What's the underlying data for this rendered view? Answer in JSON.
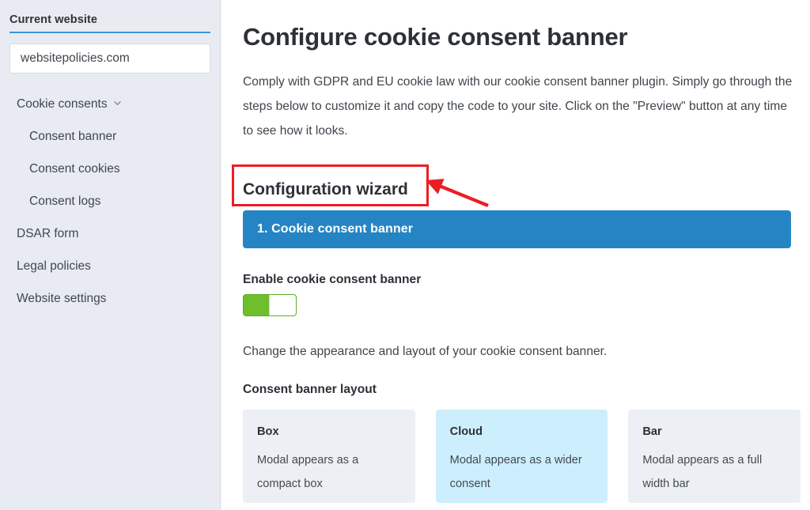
{
  "sidebar": {
    "header_title": "Current website",
    "website_select": {
      "value": "websitepolicies.com"
    },
    "items": [
      {
        "label": "Cookie consents",
        "icon": "chevron-down-icon",
        "sub": false,
        "expandable": true
      },
      {
        "label": "Consent banner",
        "sub": true
      },
      {
        "label": "Consent cookies",
        "sub": true
      },
      {
        "label": "Consent logs",
        "sub": true
      },
      {
        "label": "DSAR form",
        "sub": false
      },
      {
        "label": "Legal policies",
        "sub": false
      },
      {
        "label": "Website settings",
        "sub": false
      }
    ]
  },
  "main": {
    "page_title": "Configure cookie consent banner",
    "intro": "Comply with GDPR and EU cookie law with our cookie consent banner plugin. Simply go through the steps below to customize it and copy the code to your site. Click on the \"Preview\" button at any time to see how it looks.",
    "section_title": "Configuration wizard",
    "wizard_step": "1. Cookie consent banner",
    "enable_label": "Enable cookie consent banner",
    "toggle_state": "on",
    "appearance_text": "Change the appearance and layout of your cookie consent banner.",
    "layout_label": "Consent banner layout",
    "layout_options": [
      {
        "title": "Box",
        "desc": "Modal appears as a compact box",
        "selected": false
      },
      {
        "title": "Cloud",
        "desc": "Modal appears as a wider consent",
        "selected": true
      },
      {
        "title": "Bar",
        "desc": "Modal appears as a full width bar",
        "selected": false
      }
    ]
  },
  "annotation": {
    "type": "red-highlight-box-with-arrow",
    "target": "Configuration wizard"
  },
  "colors": {
    "sidebar_bg": "#e8ecf2",
    "accent_blue": "#3d95d3",
    "wizard_blue": "#2585c4",
    "toggle_green": "#6fbe2c",
    "card_bg": "#eceff4",
    "card_selected_bg": "#cdeefd",
    "annotation_red": "#ec1c24"
  }
}
